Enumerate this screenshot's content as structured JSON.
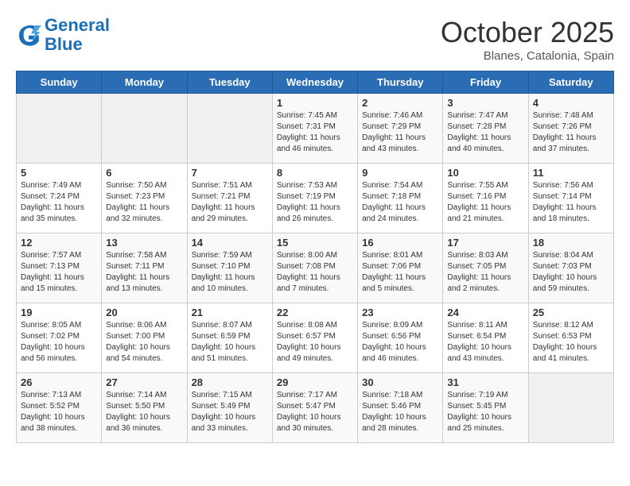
{
  "logo": {
    "line1": "General",
    "line2": "Blue"
  },
  "title": "October 2025",
  "subtitle": "Blanes, Catalonia, Spain",
  "headers": [
    "Sunday",
    "Monday",
    "Tuesday",
    "Wednesday",
    "Thursday",
    "Friday",
    "Saturday"
  ],
  "weeks": [
    [
      {
        "day": "",
        "info": ""
      },
      {
        "day": "",
        "info": ""
      },
      {
        "day": "",
        "info": ""
      },
      {
        "day": "1",
        "info": "Sunrise: 7:45 AM\nSunset: 7:31 PM\nDaylight: 11 hours\nand 46 minutes."
      },
      {
        "day": "2",
        "info": "Sunrise: 7:46 AM\nSunset: 7:29 PM\nDaylight: 11 hours\nand 43 minutes."
      },
      {
        "day": "3",
        "info": "Sunrise: 7:47 AM\nSunset: 7:28 PM\nDaylight: 11 hours\nand 40 minutes."
      },
      {
        "day": "4",
        "info": "Sunrise: 7:48 AM\nSunset: 7:26 PM\nDaylight: 11 hours\nand 37 minutes."
      }
    ],
    [
      {
        "day": "5",
        "info": "Sunrise: 7:49 AM\nSunset: 7:24 PM\nDaylight: 11 hours\nand 35 minutes."
      },
      {
        "day": "6",
        "info": "Sunrise: 7:50 AM\nSunset: 7:23 PM\nDaylight: 11 hours\nand 32 minutes."
      },
      {
        "day": "7",
        "info": "Sunrise: 7:51 AM\nSunset: 7:21 PM\nDaylight: 11 hours\nand 29 minutes."
      },
      {
        "day": "8",
        "info": "Sunrise: 7:53 AM\nSunset: 7:19 PM\nDaylight: 11 hours\nand 26 minutes."
      },
      {
        "day": "9",
        "info": "Sunrise: 7:54 AM\nSunset: 7:18 PM\nDaylight: 11 hours\nand 24 minutes."
      },
      {
        "day": "10",
        "info": "Sunrise: 7:55 AM\nSunset: 7:16 PM\nDaylight: 11 hours\nand 21 minutes."
      },
      {
        "day": "11",
        "info": "Sunrise: 7:56 AM\nSunset: 7:14 PM\nDaylight: 11 hours\nand 18 minutes."
      }
    ],
    [
      {
        "day": "12",
        "info": "Sunrise: 7:57 AM\nSunset: 7:13 PM\nDaylight: 11 hours\nand 15 minutes."
      },
      {
        "day": "13",
        "info": "Sunrise: 7:58 AM\nSunset: 7:11 PM\nDaylight: 11 hours\nand 13 minutes."
      },
      {
        "day": "14",
        "info": "Sunrise: 7:59 AM\nSunset: 7:10 PM\nDaylight: 11 hours\nand 10 minutes."
      },
      {
        "day": "15",
        "info": "Sunrise: 8:00 AM\nSunset: 7:08 PM\nDaylight: 11 hours\nand 7 minutes."
      },
      {
        "day": "16",
        "info": "Sunrise: 8:01 AM\nSunset: 7:06 PM\nDaylight: 11 hours\nand 5 minutes."
      },
      {
        "day": "17",
        "info": "Sunrise: 8:03 AM\nSunset: 7:05 PM\nDaylight: 11 hours\nand 2 minutes."
      },
      {
        "day": "18",
        "info": "Sunrise: 8:04 AM\nSunset: 7:03 PM\nDaylight: 10 hours\nand 59 minutes."
      }
    ],
    [
      {
        "day": "19",
        "info": "Sunrise: 8:05 AM\nSunset: 7:02 PM\nDaylight: 10 hours\nand 56 minutes."
      },
      {
        "day": "20",
        "info": "Sunrise: 8:06 AM\nSunset: 7:00 PM\nDaylight: 10 hours\nand 54 minutes."
      },
      {
        "day": "21",
        "info": "Sunrise: 8:07 AM\nSunset: 6:59 PM\nDaylight: 10 hours\nand 51 minutes."
      },
      {
        "day": "22",
        "info": "Sunrise: 8:08 AM\nSunset: 6:57 PM\nDaylight: 10 hours\nand 49 minutes."
      },
      {
        "day": "23",
        "info": "Sunrise: 8:09 AM\nSunset: 6:56 PM\nDaylight: 10 hours\nand 46 minutes."
      },
      {
        "day": "24",
        "info": "Sunrise: 8:11 AM\nSunset: 6:54 PM\nDaylight: 10 hours\nand 43 minutes."
      },
      {
        "day": "25",
        "info": "Sunrise: 8:12 AM\nSunset: 6:53 PM\nDaylight: 10 hours\nand 41 minutes."
      }
    ],
    [
      {
        "day": "26",
        "info": "Sunrise: 7:13 AM\nSunset: 5:52 PM\nDaylight: 10 hours\nand 38 minutes."
      },
      {
        "day": "27",
        "info": "Sunrise: 7:14 AM\nSunset: 5:50 PM\nDaylight: 10 hours\nand 36 minutes."
      },
      {
        "day": "28",
        "info": "Sunrise: 7:15 AM\nSunset: 5:49 PM\nDaylight: 10 hours\nand 33 minutes."
      },
      {
        "day": "29",
        "info": "Sunrise: 7:17 AM\nSunset: 5:47 PM\nDaylight: 10 hours\nand 30 minutes."
      },
      {
        "day": "30",
        "info": "Sunrise: 7:18 AM\nSunset: 5:46 PM\nDaylight: 10 hours\nand 28 minutes."
      },
      {
        "day": "31",
        "info": "Sunrise: 7:19 AM\nSunset: 5:45 PM\nDaylight: 10 hours\nand 25 minutes."
      },
      {
        "day": "",
        "info": ""
      }
    ]
  ]
}
